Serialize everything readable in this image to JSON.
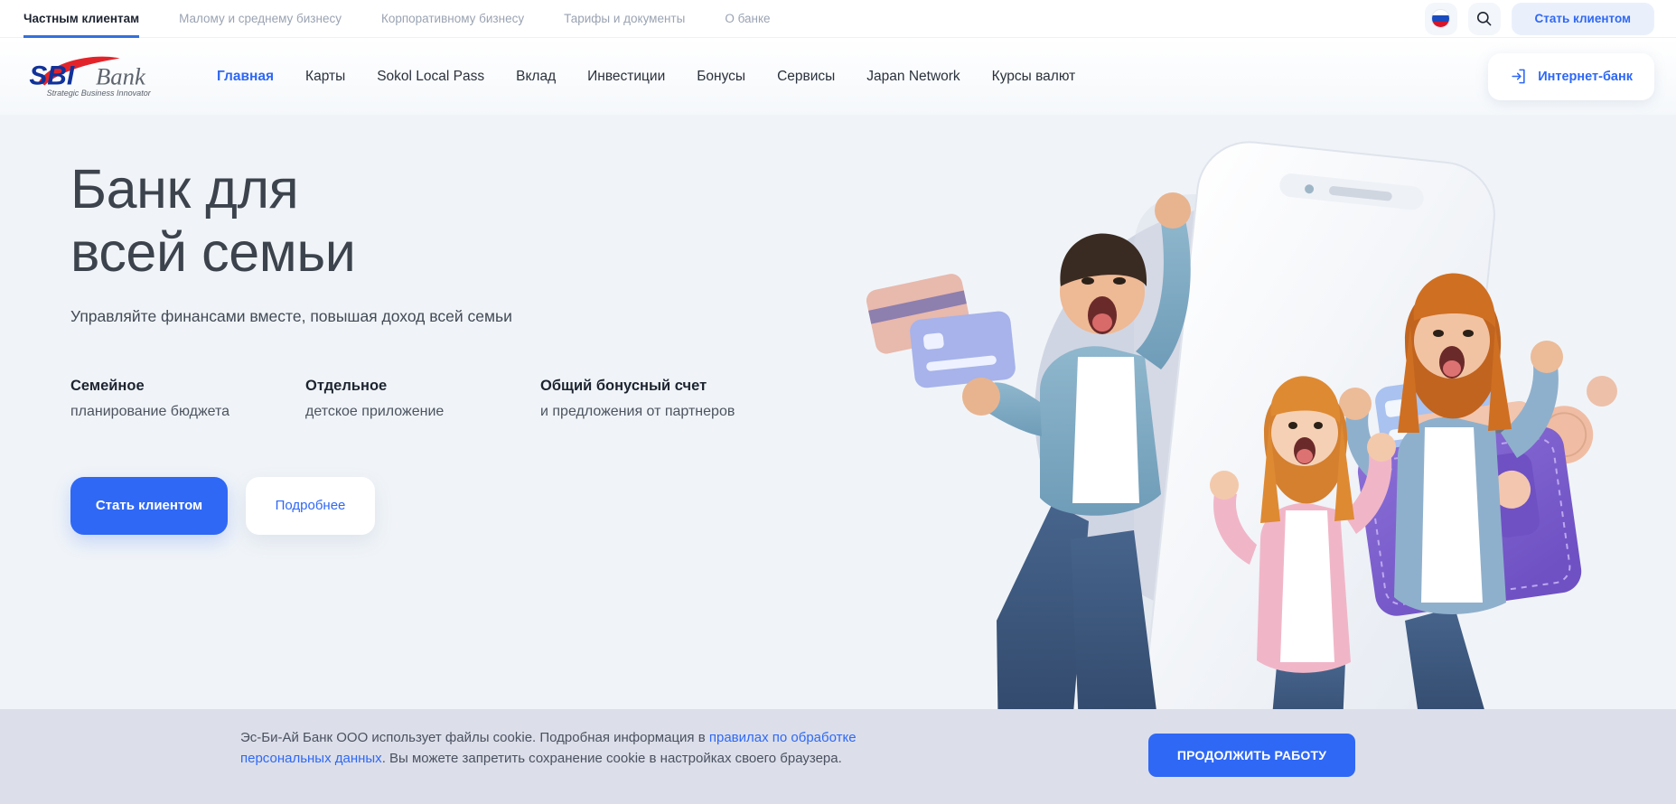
{
  "topbar": {
    "tabs": [
      {
        "label": "Частным клиентам",
        "active": true
      },
      {
        "label": "Малому и среднему бизнесу",
        "active": false
      },
      {
        "label": "Корпоративному бизнесу",
        "active": false
      },
      {
        "label": "Тарифы и документы",
        "active": false
      },
      {
        "label": "О банке",
        "active": false
      }
    ],
    "language": "RU",
    "search_icon": "search-icon",
    "become_client_label": "Стать клиентом"
  },
  "header": {
    "logo": {
      "mark": "SBI",
      "word": "Bank",
      "tagline": "Strategic Business Innovator"
    },
    "nav": [
      {
        "label": "Главная",
        "active": true
      },
      {
        "label": "Карты",
        "active": false
      },
      {
        "label": "Sokol Local Pass",
        "active": false
      },
      {
        "label": "Вклад",
        "active": false
      },
      {
        "label": "Инвестиции",
        "active": false
      },
      {
        "label": "Бонусы",
        "active": false
      },
      {
        "label": "Сервисы",
        "active": false
      },
      {
        "label": "Japan Network",
        "active": false
      },
      {
        "label": "Курсы валют",
        "active": false
      }
    ],
    "internet_bank_label": "Интернет-банк",
    "internet_bank_icon": "login-arrow-icon"
  },
  "hero": {
    "title": "Банк для\nвсей семьи",
    "subtitle": "Управляйте финансами вместе, повышая доход всей семьи",
    "features": [
      {
        "title": "Семейное",
        "text": "планирование бюджета"
      },
      {
        "title": "Отдельное",
        "text": "детское приложение"
      },
      {
        "title": "Общий бонусный счет",
        "text": "и предложения от партнеров"
      }
    ],
    "primary_cta": "Стать клиентом",
    "secondary_cta": "Подробнее",
    "carousel": {
      "prev_icon": "chevron-left-icon",
      "next_icon": "chevron-right-icon",
      "slides": 5,
      "active_index": 0
    }
  },
  "cookie": {
    "text_part1": "Эс-Би-Ай Банк ООО использует файлы cookie. Подробная информация в ",
    "link_text": "правилах по обработке персональных данных",
    "text_part2": ". Вы можете запретить сохранение cookie в настройках своего браузера.",
    "button_label": "ПРОДОЛЖИТЬ РАБОТУ"
  },
  "colors": {
    "accent_blue": "#2f68f5",
    "tab_underline": "#3370dc",
    "hero_bg": "#f0f4f8",
    "cookie_bg": "#dcdfe9",
    "logo_blue": "#10329a",
    "logo_red": "#e2242a",
    "heading": "#3c434c"
  }
}
